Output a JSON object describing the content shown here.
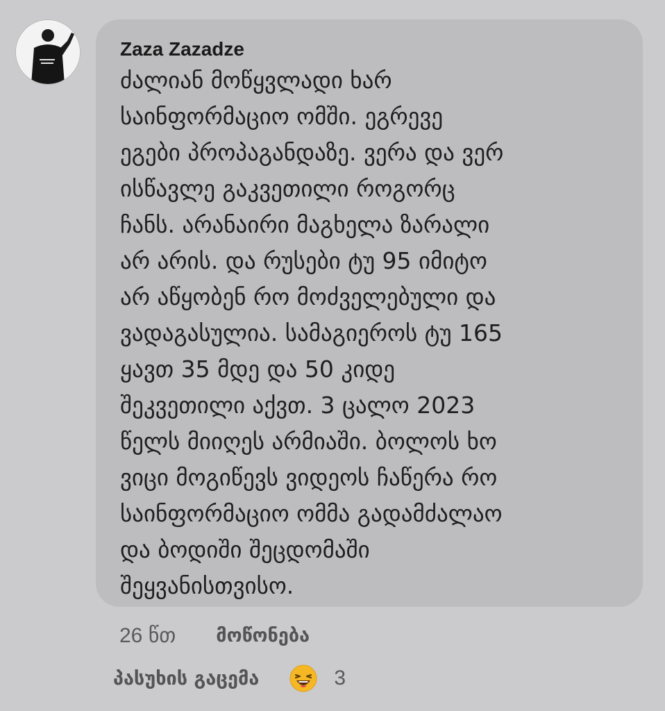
{
  "comment": {
    "author": "Zaza Zazadze",
    "text_lines": [
      "ძალიან მოწყვლადი ხარ",
      "საინფორმაციო ომში. ეგრევე",
      "ეგები პროპაგანდაზე. ვერა და ვერ",
      "ისწავლე გაკვეთილი როგორც",
      "ჩანს. არანაირი მაგხელა ზარალი",
      "არ არის. და რუსები ტუ 95 იმიტო",
      "არ აწყობენ რო მოძველებული და",
      "ვადაგასულია. სამაგიეროს ტუ 165",
      "ყავთ 35 მდე და 50 კიდე",
      "შეკვეთილი აქვთ. 3 ცალო 2023",
      "წელს მიიღეს არმიაში. ბოლოს ხო",
      "ვიცი მოგიწევს ვიდეოს ჩაწერა რო",
      "საინფორმაციო ომმა გადამძალაო",
      "და ბოდიში შეცდომაში",
      "შეყვანისთვისო."
    ],
    "time": "26 წთ",
    "like_label": "მოწონება",
    "reply_label": "პასუხის გაცემა",
    "reaction": {
      "icon": "laughing-emoji-icon",
      "count": "3"
    }
  },
  "colors": {
    "background": "#cbcbcd",
    "bubble": "#bdbdbf",
    "text": "#1e1e20",
    "secondary_text": "#5a5a5c",
    "emoji_face": "#f5b824"
  }
}
